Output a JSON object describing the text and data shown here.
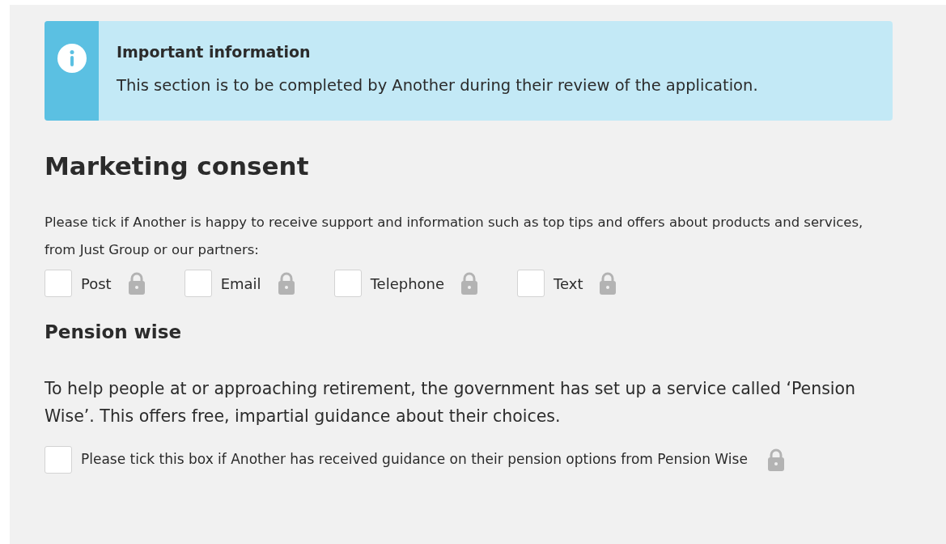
{
  "info_alert": {
    "title": "Important information",
    "text": "This section is to be completed by Another during their review of the application."
  },
  "marketing": {
    "heading": "Marketing consent",
    "intro": "Please tick if Another is happy to receive support and information such as top tips and offers about products and services, from Just Group or our partners:",
    "options": [
      {
        "label": "Post",
        "checked": false
      },
      {
        "label": "Email",
        "checked": false
      },
      {
        "label": "Telephone",
        "checked": false
      },
      {
        "label": "Text",
        "checked": false
      }
    ]
  },
  "pension_wise": {
    "heading": "Pension wise",
    "text": "To help people at or approaching retirement, the government has set up a service called ‘Pension Wise’. This offers free, impartial guidance about their choices.",
    "consent": {
      "label": "Please tick this box if Another has received guidance on their pension options from Pension Wise",
      "checked": false
    }
  }
}
